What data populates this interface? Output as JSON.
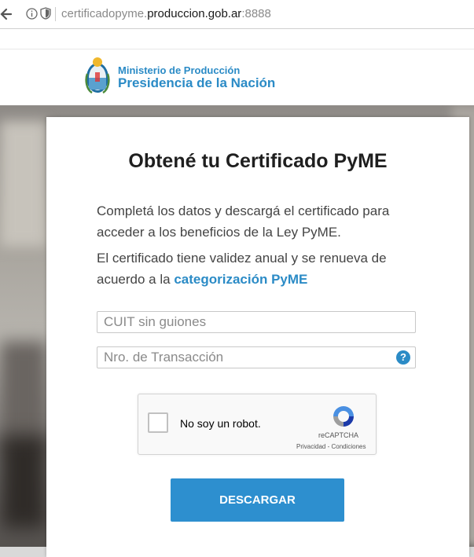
{
  "browser": {
    "url_prefix": "certificadopyme.",
    "url_host": "produccion.gob.ar",
    "url_port": ":8888"
  },
  "header": {
    "ministry": "Ministerio de Producción",
    "presidency": "Presidencia de la Nación",
    "brand_color": "#2b8bc6"
  },
  "form": {
    "title": "Obtené tu Certificado PyME",
    "para1": "Completá los datos y descargá el certificado para acceder a los beneficios de la Ley PyME.",
    "para2_text": "El certificado tiene validez anual y se renueva de acuerdo a la",
    "para2_link": "categorización PyME",
    "cuit_placeholder": "CUIT sin guiones",
    "transaction_placeholder": "Nro. de Transacción",
    "help_symbol": "?",
    "captcha": {
      "label": "No soy un robot.",
      "brand": "reCAPTCHA",
      "terms": "Privacidad - Condiciones"
    },
    "submit_label": "DESCARGAR",
    "button_color": "#2d8fcf"
  },
  "icons": [
    "back-arrow-icon",
    "info-icon",
    "shield-icon",
    "crest-icon",
    "help-icon",
    "recaptcha-logo-icon"
  ]
}
